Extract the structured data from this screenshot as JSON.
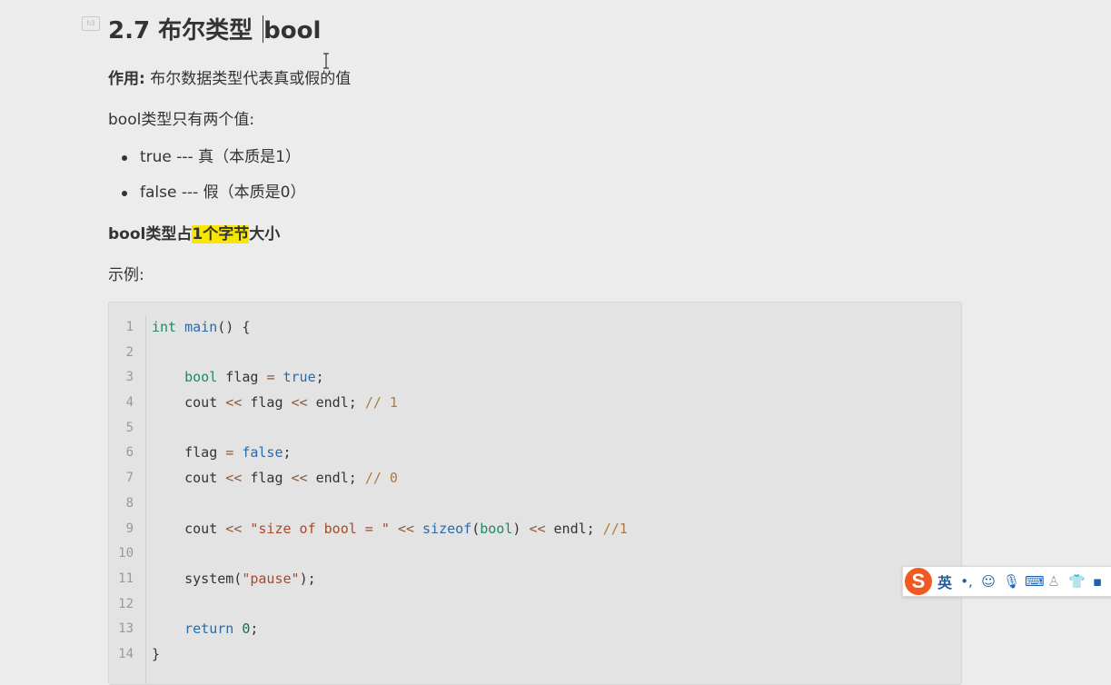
{
  "heading": {
    "badge": "h3",
    "text": "2.7 布尔类型 ",
    "tail": "bool"
  },
  "purpose": {
    "label": "作用:",
    "text": " 布尔数据类型代表真或假的值"
  },
  "values_intro": "bool类型只有两个值:",
  "bullets": [
    {
      "text": "true  --- 真（本质是1）"
    },
    {
      "text": "false --- 假（本质是0）"
    }
  ],
  "size_line": {
    "pre": "bool类型占",
    "highlight": "1个字节",
    "post": "大小"
  },
  "example_label": "示例:",
  "code": {
    "line_numbers": [
      "1",
      "2",
      "3",
      "4",
      "5",
      "6",
      "7",
      "8",
      "9",
      "10",
      "11",
      "12",
      "13",
      "14"
    ]
  },
  "ime": {
    "logo": "S",
    "mode": "英",
    "icons": [
      "punctuation-icon",
      "emoji-icon",
      "microphone-icon",
      "keyboard-icon",
      "user-icon",
      "skin-icon",
      "menu-icon"
    ]
  },
  "colors": {
    "highlight": "#f7e600",
    "ime_logo": "#f05a22",
    "keyword": "#2b6aa8"
  }
}
